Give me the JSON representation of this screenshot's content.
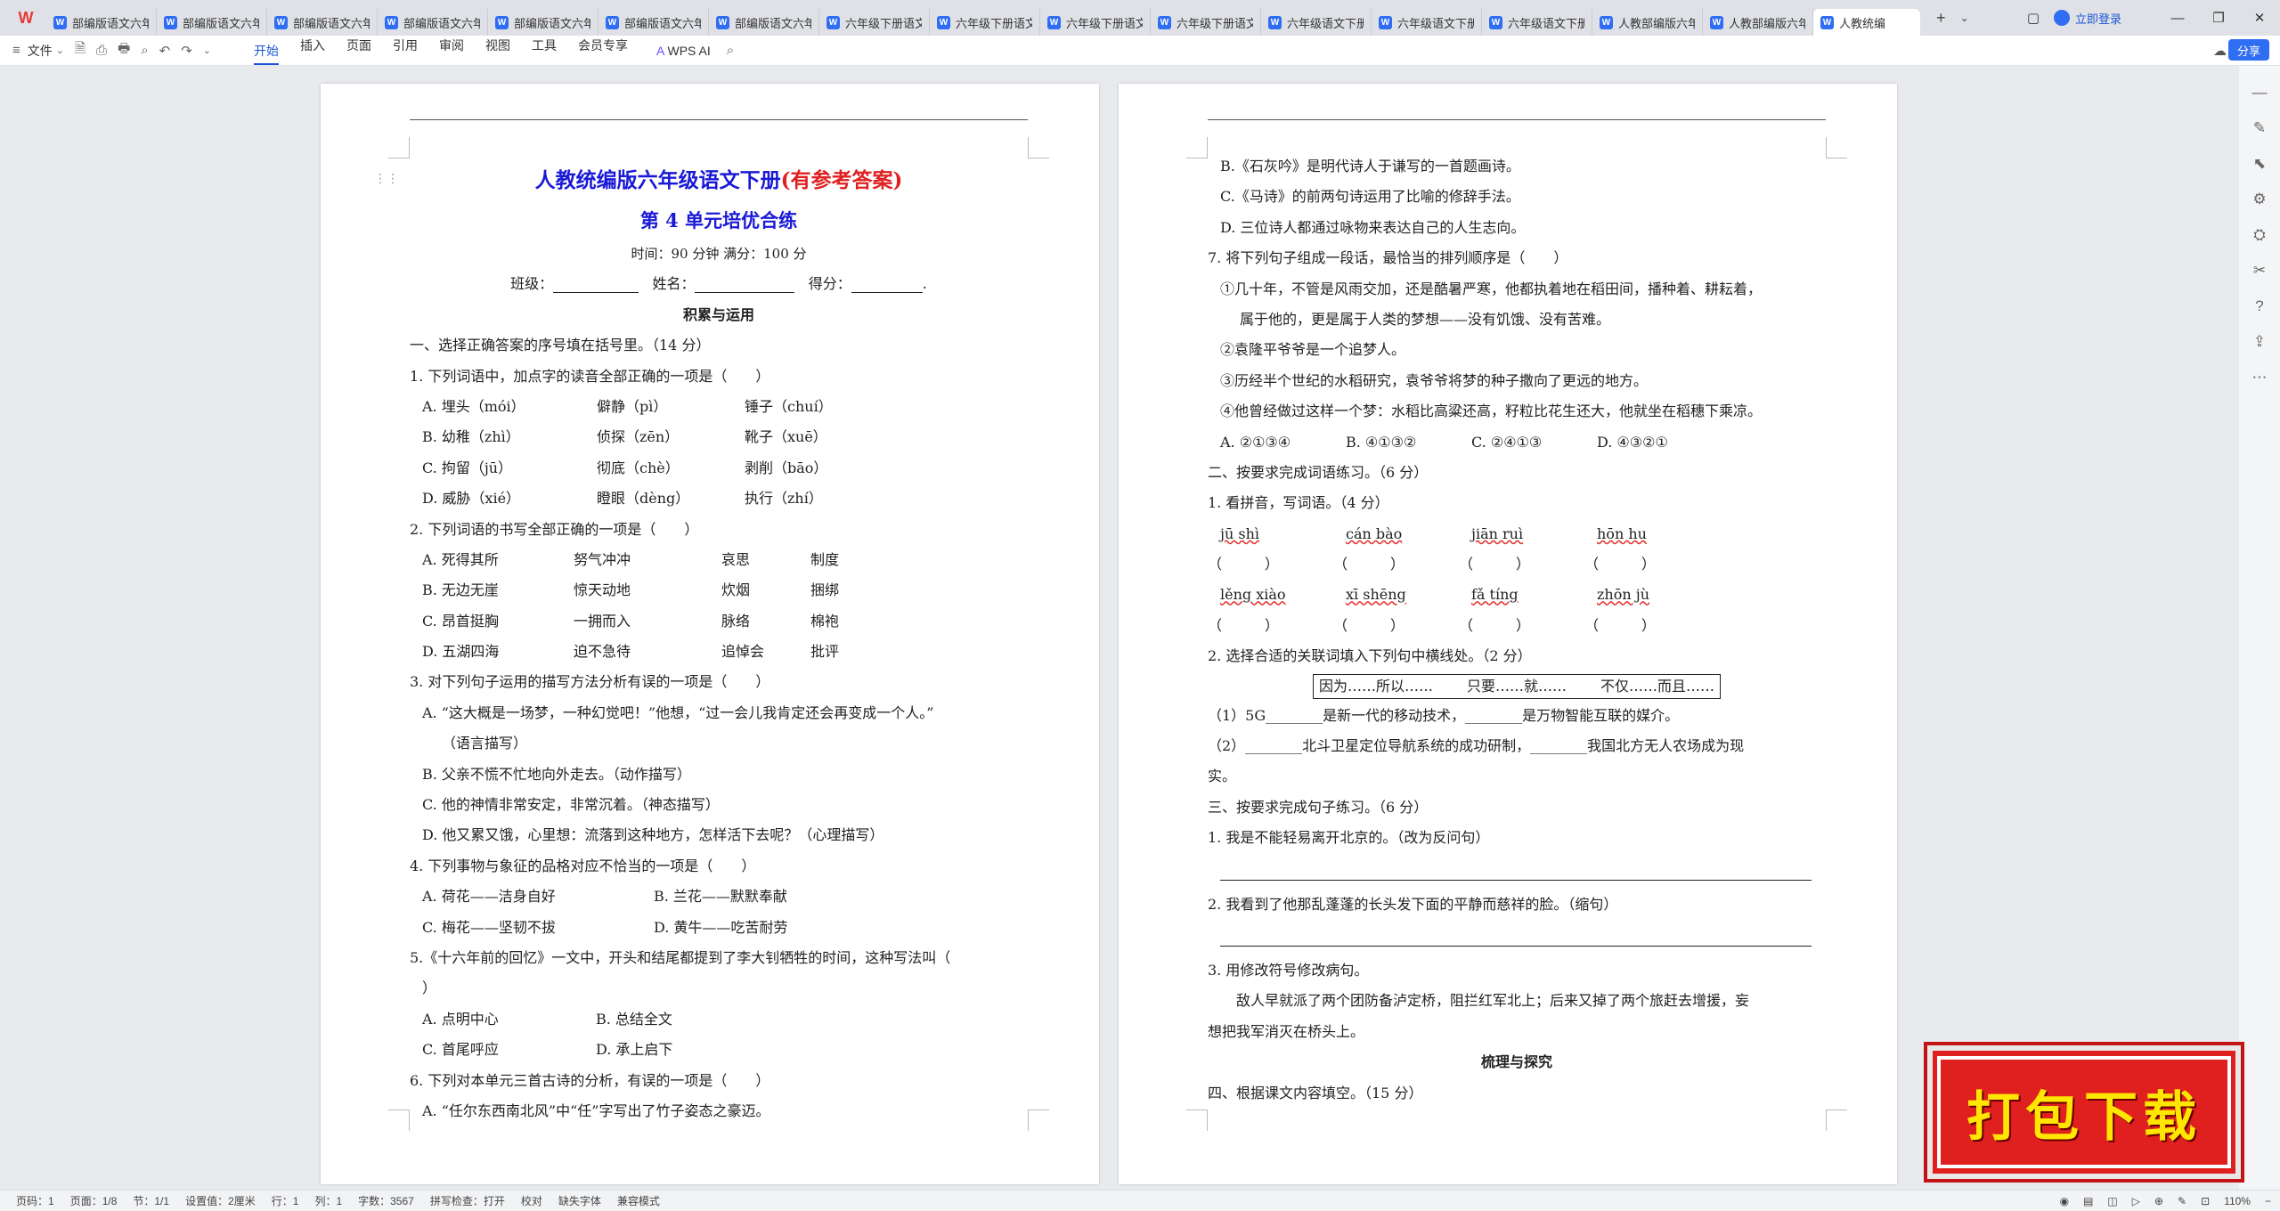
{
  "tabs": [
    "部编版语文六年",
    "部编版语文六年",
    "部编版语文六年",
    "部编版语文六年",
    "部编版语文六年",
    "部编版语文六年",
    "部编版语文六年",
    "六年级下册语文",
    "六年级下册语文",
    "六年级下册语文",
    "六年级下册语文",
    "六年级语文下册",
    "六年级语文下册",
    "六年级语文下册",
    "人教部编版六年",
    "人教部编版六年",
    "人教统编"
  ],
  "window": {
    "login": "立即登录"
  },
  "menu": {
    "file": "文件",
    "tabs": [
      "开始",
      "插入",
      "页面",
      "引用",
      "审阅",
      "视图",
      "工具",
      "会员专享"
    ],
    "wps_ai": "WPS AI",
    "share": "分享"
  },
  "page1": {
    "title_main": "人教统编版六年级语文下册",
    "title_note": "(有参考答案)",
    "subtitle": "第 4 单元培优合练",
    "time_line": "时间：90 分钟  满分：100 分",
    "info": {
      "class": "班级：",
      "name": "姓名：",
      "score": "得分：",
      "end": "."
    },
    "section": "积累与运用",
    "q_intro": "一、选择正确答案的序号填在括号里。（14 分）",
    "q1": "1. 下列词语中，加点字的读音全部正确的一项是（　　）",
    "q1_rows": [
      [
        "A. 埋头（mói）",
        "僻静（pì）",
        "锤子（chuí）"
      ],
      [
        "B. 幼稚（zhì）",
        "侦探（zēn）",
        "靴子（xuē）"
      ],
      [
        "C. 拘留（jū）",
        "彻底（chè）",
        "剥削（bāo）"
      ],
      [
        "D. 威胁（xié）",
        "瞪眼（dèng）",
        "执行（zhí）"
      ]
    ],
    "q2": "2. 下列词语的书写全部正确的一项是（　　）",
    "q2_rows": [
      [
        "A. 死得其所",
        "努气冲冲",
        "哀思",
        "制度"
      ],
      [
        "B. 无边无崖",
        "惊天动地",
        "炊烟",
        "捆绑"
      ],
      [
        "C. 昂首挺胸",
        "一拥而入",
        "脉络",
        "棉袍"
      ],
      [
        "D. 五湖四海",
        "迫不急待",
        "追悼会",
        "批评"
      ]
    ],
    "q3": "3. 对下列句子运用的描写方法分析有误的一项是（　　）",
    "q3_a1": "A. “这大概是一场梦，一种幻觉吧！”他想，“过一会儿我肯定还会再变成一个人。”",
    "q3_a2": "（语言描写）",
    "q3_b": "B. 父亲不慌不忙地向外走去。（动作描写）",
    "q3_c": "C. 他的神情非常安定，非常沉着。（神态描写）",
    "q3_d": "D. 他又累又饿，心里想：流落到这种地方，怎样活下去呢？（心理描写）",
    "q4": "4. 下列事物与象征的品格对应不恰当的一项是（　　）",
    "q4_rows": [
      [
        "A. 荷花——洁身自好",
        "B. 兰花——默默奉献"
      ],
      [
        "C. 梅花——坚韧不拔",
        "D. 黄牛——吃苦耐劳"
      ]
    ],
    "q5_1": "5.《十六年前的回忆》一文中，开头和结尾都提到了李大钊牺牲的时间，这种写法叫（",
    "q5_2": "）",
    "q5_rows": [
      [
        "A. 点明中心",
        "B. 总结全文"
      ],
      [
        "C. 首尾呼应",
        "D. 承上启下"
      ]
    ],
    "q6": "6. 下列对本单元三首古诗的分析，有误的一项是（　　）",
    "q6_a": "A. “任尔东西南北风”中“任”字写出了竹子姿态之豪迈。"
  },
  "page2": {
    "lines_top": [
      "B.《石灰吟》是明代诗人于谦写的一首题画诗。",
      "C.《马诗》的前两句诗运用了比喻的修辞手法。",
      "D. 三位诗人都通过咏物来表达自己的人生志向。"
    ],
    "q7": "7. 将下列句子组成一段话，最恰当的排列顺序是（　　）",
    "q7_1a": "①几十年，不管是风雨交加，还是酷暑严寒，他都执着地在稻田间，播种着、耕耘着，",
    "q7_1b": "属于他的，更是属于人类的梦想——没有饥饿、没有苦难。",
    "q7_2": "②袁隆平爷爷是一个追梦人。",
    "q7_3": "③历经半个世纪的水稻研究，袁爷爷将梦的种子撒向了更远的地方。",
    "q7_4": "④他曾经做过这样一个梦：水稻比高粱还高，籽粒比花生还大，他就坐在稻穗下乘凉。",
    "q7_opts": [
      "A. ②①③④",
      "B. ④①③②",
      "C. ②④①③",
      "D. ④③②①"
    ],
    "sec2": "二、按要求完成词语练习。（6 分）",
    "p1": "1. 看拼音，写词语。（4 分）",
    "pinyin1": [
      "jū shì",
      "cán bào",
      "jiān ruì",
      "hōn hu"
    ],
    "pinyin2": [
      "lěng xiào",
      "xī shēng",
      "fǎ tíng",
      "zhōn jù"
    ],
    "paren": "（　　　）",
    "p2": "2. 选择合适的关联词填入下列句中横线处。（2 分）",
    "box": [
      "因为……所以……",
      "只要……就……",
      "不仅……而且……"
    ],
    "p2_1": "（1）5G________是新一代的移动技术，________是万物智能互联的媒介。",
    "p2_2": "（2）________北斗卫星定位导航系统的成功研制，________我国北方无人农场成为现",
    "p2_2b": "实。",
    "sec3": "三、按要求完成句子练习。（6 分）",
    "s1": "1. 我是不能轻易离开北京的。（改为反问句）",
    "s2": "2. 我看到了他那乱蓬蓬的长头发下面的平静而慈祥的脸。（缩句）",
    "s3": "3. 用修改符号修改病句。",
    "s3_text1": "　　敌人早就派了两个团防备泸定桥，阻拦红军北上；后来又掉了两个旅赶去增援，妄",
    "s3_text2": "想把我军消灭在桥头上。",
    "section2": "梳理与探究",
    "sec4": "四、根据课文内容填空。（15 分）"
  },
  "status": {
    "page": "页码：1",
    "pages": "页面：1/8",
    "section": "节：1/1",
    "setting": "设置值：2厘米",
    "row": "行：1",
    "col": "列：1",
    "words": "字数：3567",
    "spell": "拼写检查：打开",
    "proof": "校对",
    "font": "缺失字体",
    "compat": "兼容模式",
    "zoom": "110%"
  },
  "download_badge": "打包下载"
}
